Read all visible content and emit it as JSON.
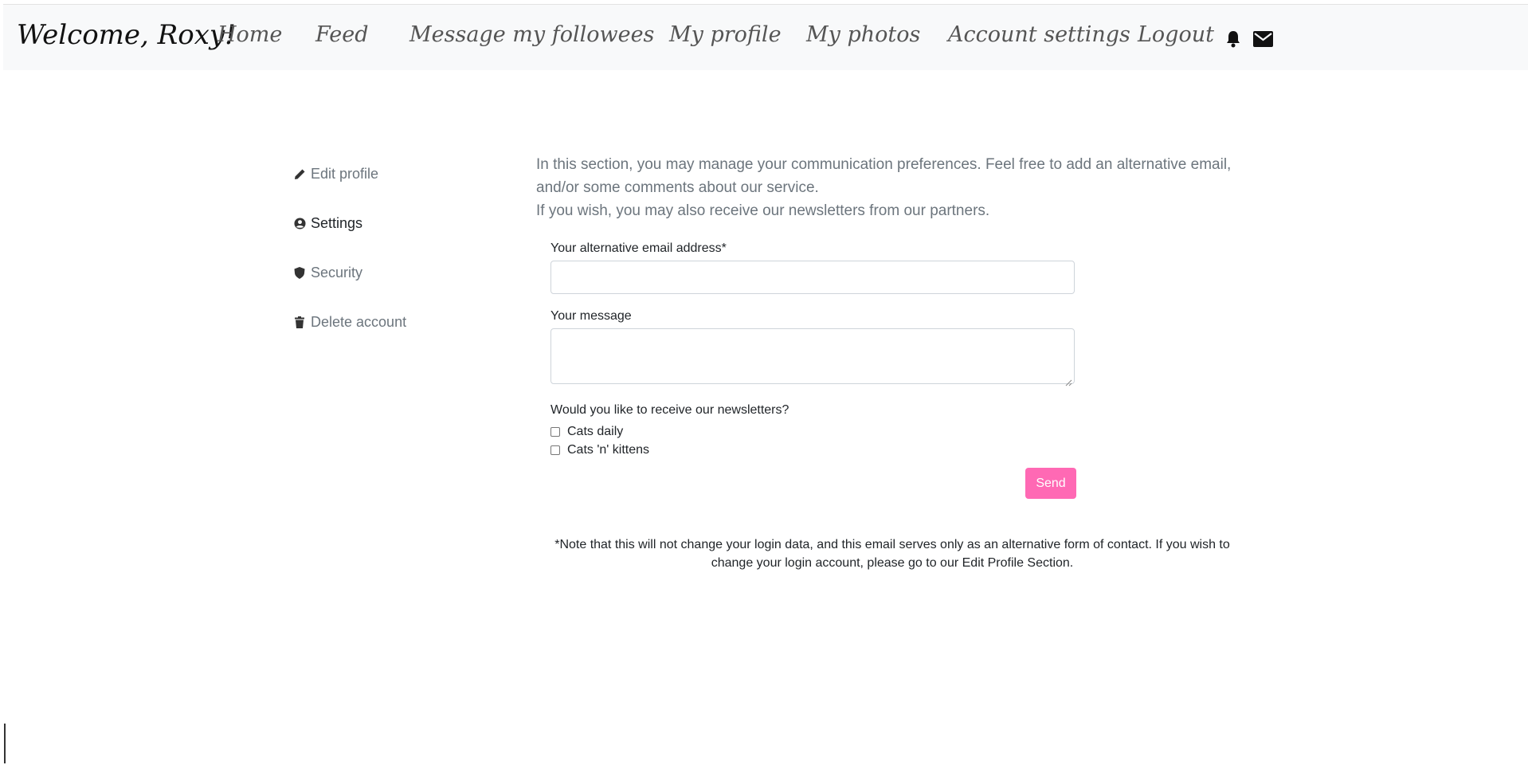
{
  "navbar": {
    "brand": "Welcome, Roxy!",
    "links": [
      "Home",
      "Feed",
      "Message my followees",
      "My profile",
      "My photos",
      "Account settings",
      "Logout"
    ],
    "icons": [
      "bell-icon",
      "envelope-icon"
    ]
  },
  "sidebar": {
    "items": [
      {
        "label": "Edit profile",
        "icon": "pencil-icon"
      },
      {
        "label": "Settings",
        "icon": "user-circle-icon",
        "active": true
      },
      {
        "label": "Security",
        "icon": "shield-icon"
      },
      {
        "label": "Delete account",
        "icon": "trash-icon"
      }
    ]
  },
  "main": {
    "intro_line1": "In this section, you may manage your communication preferences. Feel free to add an alternative email, and/or some comments about our service.",
    "intro_line2": "If you wish, you may also receive our newsletters from our partners.",
    "form": {
      "email_label": "Your alternative email address*",
      "email_value": "",
      "message_label": "Your message",
      "message_value": "",
      "newsletter_question": "Would you like to receive our newsletters?",
      "options": [
        {
          "label": "Cats daily",
          "checked": false
        },
        {
          "label": "Cats 'n' kittens",
          "checked": false
        }
      ],
      "send_label": "Send"
    },
    "note": "*Note that this will not change your login data, and this email serves only as an alternative form of contact. If you wish to change your login account, please go to our Edit Profile Section."
  },
  "colors": {
    "accent": "#ff69b4",
    "navbar_bg": "#f8f9fa",
    "muted_text": "#6c757d"
  }
}
